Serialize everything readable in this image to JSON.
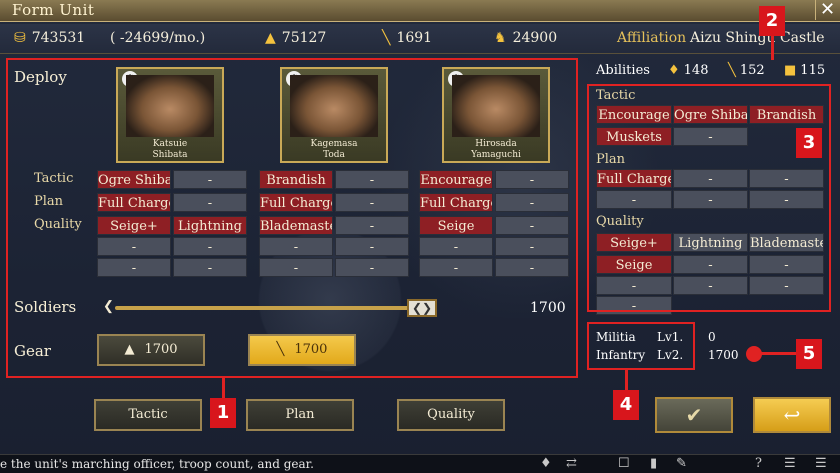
{
  "window": {
    "title": "Form Unit",
    "close_label": "✕"
  },
  "resources": {
    "gold": "743531",
    "gold_rate": "(      -24699/mo.)",
    "food": "75127",
    "arms": "1691",
    "troops": "24900",
    "affiliation_label": "Affiliation",
    "affiliation_value": "Aizu Shingu Castle"
  },
  "deploy": {
    "label": "Deploy",
    "officers": [
      {
        "name_line1": "Katsuie",
        "name_line2": "Shibata"
      },
      {
        "name_line1": "Kagemasa",
        "name_line2": "Toda"
      },
      {
        "name_line1": "Hirosada",
        "name_line2": "Yamaguchi"
      }
    ],
    "row_labels": {
      "tactic": "Tactic",
      "plan": "Plan",
      "quality": "Quality"
    },
    "officer_slots": [
      {
        "tactic": [
          "Ogre Shiba",
          "-"
        ],
        "plan": [
          "Full Charge",
          "-"
        ],
        "quality": [
          "Seige+",
          "Lightning",
          "-",
          "-",
          "-",
          "-"
        ]
      },
      {
        "tactic": [
          "Brandish",
          "-"
        ],
        "plan": [
          "Full Charge",
          "-"
        ],
        "quality": [
          "Blademaster",
          "-",
          "-",
          "-",
          "-",
          "-"
        ]
      },
      {
        "tactic": [
          "Encourage",
          "-"
        ],
        "plan": [
          "Full Charge",
          "-"
        ],
        "quality": [
          "Seige",
          "-",
          "-",
          "-",
          "-",
          "-"
        ]
      }
    ]
  },
  "soldiers": {
    "label": "Soldiers",
    "value": "1700",
    "fill": 0.93
  },
  "gear": {
    "label": "Gear",
    "items": [
      {
        "value": "1700"
      },
      {
        "value": "1700"
      }
    ]
  },
  "bottom_buttons": {
    "tactic": "Tactic",
    "plan": "Plan",
    "quality": "Quality"
  },
  "abilities": {
    "label": "Abilities",
    "power": "148",
    "attack": "152",
    "defense": "115"
  },
  "summary": {
    "tactic_label": "Tactic",
    "tactics": [
      "Encourage",
      "Ogre Shiba",
      "Brandish",
      "Muskets",
      "-"
    ],
    "plan_label": "Plan",
    "plans": [
      "Full Charge",
      "-",
      "-",
      "-",
      "-",
      "-"
    ],
    "quality_label": "Quality",
    "qualities": [
      "Seige+",
      "Lightning",
      "Blademaster",
      "Seige",
      "-",
      "-",
      "-",
      "-",
      "-",
      "-"
    ]
  },
  "unit_type": {
    "militia": "Militia",
    "militia_lv": "Lv1.",
    "militia_count": "0",
    "infantry": "Infantry",
    "infantry_lv": "Lv2.",
    "infantry_count": "1700"
  },
  "callouts": [
    "1",
    "2",
    "3",
    "4",
    "5"
  ],
  "status_bar": {
    "text": "e the unit's marching officer, troop count, and gear."
  },
  "colors": {
    "highlight_red": "#e02222",
    "gold": "#f4c23e",
    "cell_red": "#8e1f24"
  }
}
